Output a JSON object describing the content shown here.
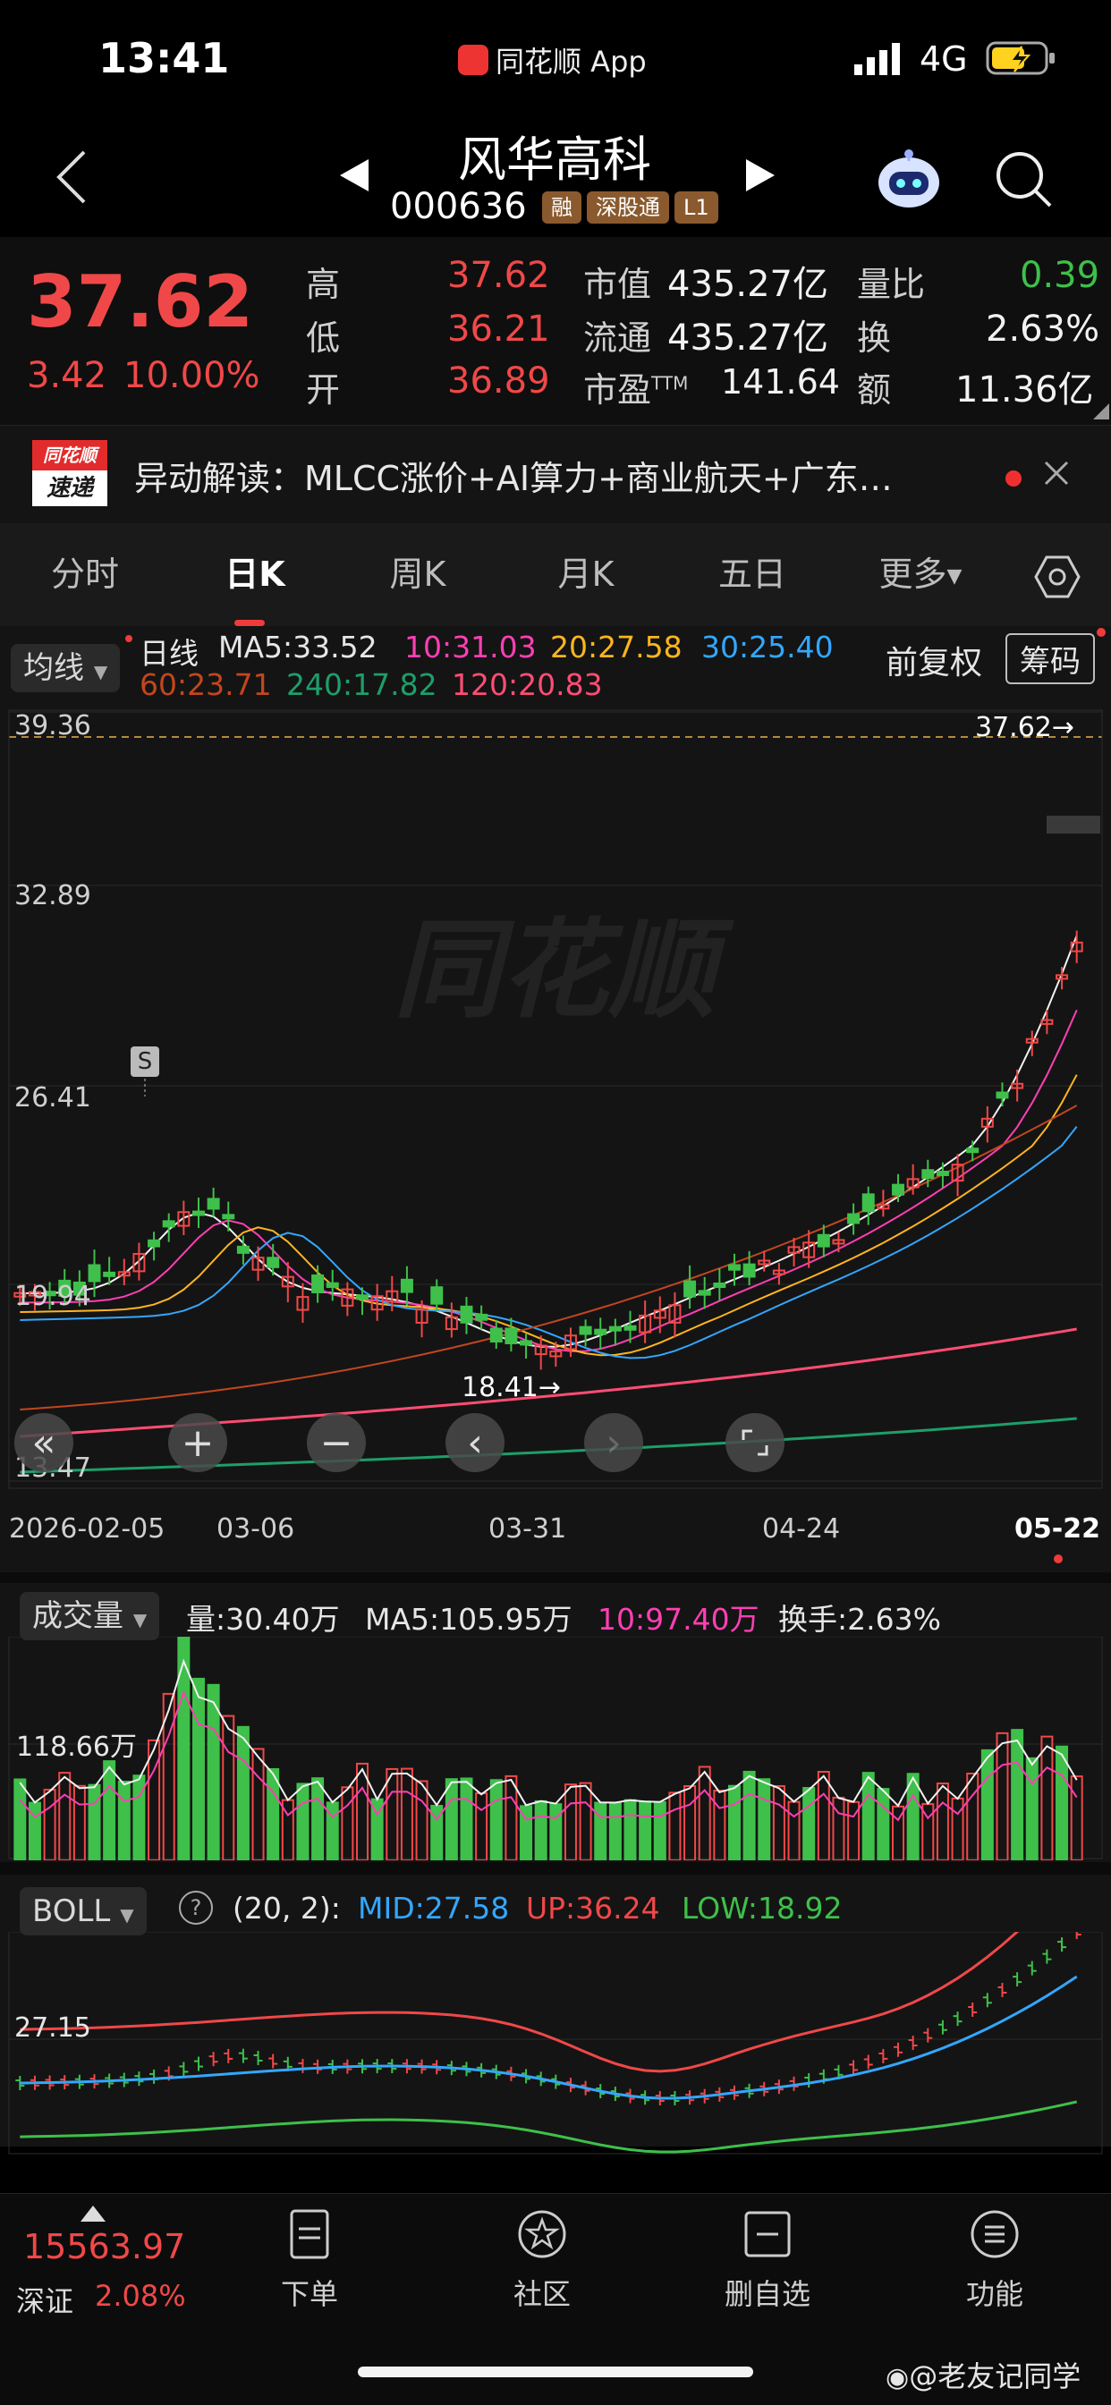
{
  "status_bar": {
    "time": "13:41",
    "app_label": "同花顺 App",
    "network": "4G"
  },
  "header": {
    "stock_name": "风华高科",
    "stock_code": "000636",
    "tags": [
      "融",
      "深股通",
      "L1"
    ]
  },
  "quote": {
    "price": "37.62",
    "change": "3.42",
    "change_pct": "10.00%",
    "fields": [
      {
        "label": "高",
        "value": "37.62"
      },
      {
        "label": "低",
        "value": "36.21"
      },
      {
        "label": "开",
        "value": "36.89"
      },
      {
        "label": "市值",
        "value": "435.27亿"
      },
      {
        "label": "流通",
        "value": "435.27亿"
      },
      {
        "label": "市盈",
        "sup": "TTM",
        "value": "141.64"
      },
      {
        "label": "量比",
        "value": "0.39"
      },
      {
        "label": "换",
        "value": "2.63%"
      },
      {
        "label": "额",
        "value": "11.36亿"
      }
    ]
  },
  "news": {
    "logo_top": "同花顺",
    "logo_bottom": "速递",
    "text": "异动解读：MLCC涨价+AI算力+商业航天+广东…"
  },
  "tabs": [
    "分时",
    "日K",
    "周K",
    "月K",
    "五日",
    "更多"
  ],
  "active_tab": "日K",
  "indicator_bar": {
    "selector": "均线",
    "title": "日线",
    "ma": [
      {
        "text": "MA5:33.52",
        "color": "#f2f2f2"
      },
      {
        "text": "10:31.03",
        "color": "#ff3fb4"
      },
      {
        "text": "20:27.58",
        "color": "#ffb51f"
      },
      {
        "text": "30:25.40",
        "color": "#33a7ff"
      },
      {
        "text": "60:23.71",
        "color": "#c2461e"
      },
      {
        "text": "240:17.82",
        "color": "#1e9e6a"
      },
      {
        "text": "120:20.83",
        "color": "#ff4d74"
      }
    ],
    "adjust": "前复权",
    "chips": "筹码"
  },
  "kline": {
    "y_labels": [
      "39.36",
      "32.89",
      "26.41",
      "19.94",
      "13.47"
    ],
    "last_price_marker": "37.62→",
    "low_marker": "18.41→",
    "signal_badge": "S",
    "watermark": "同花顺",
    "x_labels": [
      "2026-02-05",
      "03-06",
      "03-31",
      "04-24",
      "05-22"
    ]
  },
  "volume": {
    "selector": "成交量",
    "stats": [
      {
        "text": "量:30.40万",
        "color": "#e6e6e6"
      },
      {
        "text": "MA5:105.95万",
        "color": "#e6e6e6"
      },
      {
        "text": "10:97.40万",
        "color": "#ff3fb4"
      },
      {
        "text": "换手:2.63%",
        "color": "#e6e6e6"
      }
    ],
    "y_label": "118.66万"
  },
  "boll": {
    "selector": "BOLL",
    "params": "(20, 2):",
    "mid": "MID:27.58",
    "up": "UP:36.24",
    "low": "LOW:18.92",
    "y_label": "27.15"
  },
  "bottom_nav": {
    "index_value": "15563.97",
    "index_name": "深证",
    "index_change": "2.08%",
    "items": [
      "下单",
      "社区",
      "删自选",
      "功能"
    ],
    "watermark": "@老友记同学"
  },
  "colors": {
    "up": "#f04848",
    "down": "#3ec04a",
    "background": "#141414"
  }
}
